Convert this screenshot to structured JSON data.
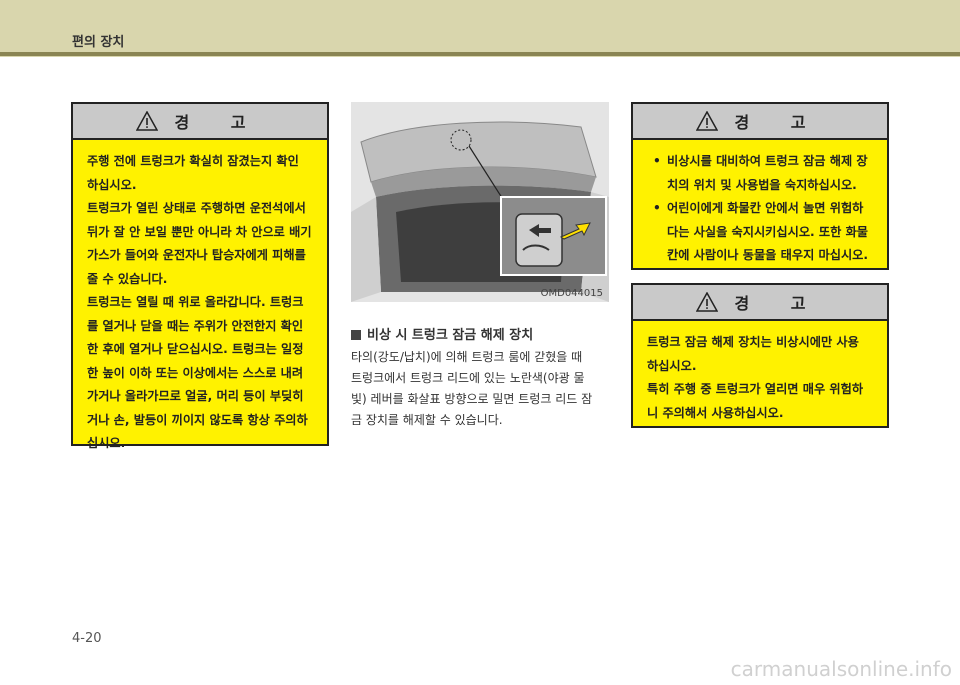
{
  "header": {
    "title": "편의 장치"
  },
  "warning_left": {
    "heading": "경 고",
    "lines": [
      "주행 전에 트렁크가 확실히 잠겼는지 확인",
      "하십시오.",
      "트렁크가 열린 상태로 주행하면 운전석에서",
      "뒤가 잘 안 보일 뿐만 아니라 차 안으로 배기",
      "가스가 들어와 운전자나 탑승자에게 피해를",
      "줄 수 있습니다.",
      "트렁크는 열릴 때 위로 올라갑니다. 트렁크",
      "를 열거나 닫을 때는 주위가 안전한지 확인",
      "한 후에 열거나 닫으십시오. 트렁크는 일정",
      "한 높이 이하 또는 이상에서는 스스로 내려",
      "가거나 올라가므로 얼굴, 머리 등이 부딪히",
      "거나 손, 발등이 끼이지 않도록 항상 주의하",
      "십시오."
    ]
  },
  "figure": {
    "caption": "OMD044015"
  },
  "section": {
    "title": "비상 시 트렁크 잠금 해제 장치",
    "lines": [
      "타의(강도/납치)에 의해 트렁크 룸에 갇혔을 때",
      "트렁크에서 트렁크 리드에 있는 노란색(야광 물",
      "빛) 레버를 화살표 방향으로 밀면 트렁크 리드 잠",
      "금 장치를 해제할 수 있습니다."
    ]
  },
  "warning_right_top": {
    "heading": "경 고",
    "bullets": [
      [
        "비상시를 대비하여 트렁크 잠금 해제 장",
        "치의 위치 및 사용법을 숙지하십시오."
      ],
      [
        "어린이에게 화물칸 안에서 놀면 위험하",
        "다는 사실을 숙지시키십시오. 또한 화물",
        "칸에 사람이나 동물을 태우지 마십시오."
      ]
    ]
  },
  "warning_right_bottom": {
    "heading": "경 고",
    "lines": [
      "트렁크 잠금 해제 장치는 비상시에만 사용",
      "하십시오.",
      "특히 주행 중 트렁크가 열리면 매우 위험하",
      "니 주의해서 사용하십시오."
    ]
  },
  "footer": {
    "page_number": "4-20"
  },
  "watermark": "carmanualsonline.info",
  "colors": {
    "warning_bg": "#fff200",
    "header_band": "#d9d6ad",
    "header_rule": "#8a8554"
  }
}
